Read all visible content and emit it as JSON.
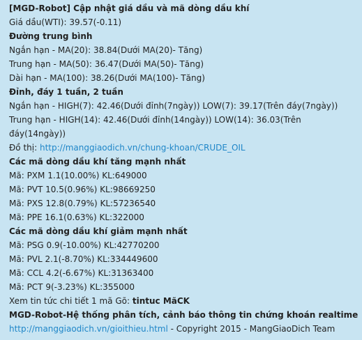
{
  "message": {
    "title": "[MGD-Robot] Cập nhật giá dầu và mã dòng dầu khí",
    "price": "Giá dầu(WTI): 39.57(-0.11)",
    "ma_heading": "Đường trung bình",
    "ma": [
      "Ngắn hạn - MA(20): 38.84(Dưới MA(20)- Tăng)",
      "Trung hạn - MA(50): 36.47(Dưới MA(50)- Tăng)",
      "Dài hạn - MA(100): 38.26(Dưới MA(100)- Tăng)"
    ],
    "peak_heading": "Đỉnh, đáy 1 tuần, 2 tuần",
    "peak": [
      "Ngắn hạn - HIGH(7): 42.46(Dưới đỉnh(7ngày)) LOW(7): 39.17(Trên đáy(7ngày))",
      "Trung hạn - HIGH(14): 42.46(Dưới đỉnh(14ngày)) LOW(14): 36.03(Trên đáy(14ngày))"
    ],
    "chart_label": "Đồ thị: ",
    "chart_link": "http://manggiaodich.vn/chung-khoan/CRUDE_OIL",
    "up_heading": "Các mã dòng dầu khí tăng mạnh nhất",
    "up": [
      "Mã: PXM 1.1(10.00%) KL:649000",
      "Mã: PVT 10.5(0.96%) KL:98669250",
      "Mã: PXS 12.8(0.79%) KL:57236540",
      "Mã: PPE 16.1(0.63%) KL:322000"
    ],
    "down_heading": "Các mã dòng dầu khí giảm mạnh nhất",
    "down": [
      "Mã: PSG 0.9(-10.00%) KL:42770200",
      "Mã: PVL 2.1(-8.70%) KL:334449600",
      "Mã: CCL 4.2(-6.67%) KL:31363400",
      "Mã: PCT 9(-3.23%) KL:355000"
    ],
    "detail_prefix": "Xem tin tức chi tiết 1 mã Gõ: ",
    "detail_command": "tintuc MãCK",
    "footer_title": "MGD-Robot-Hệ thống phân tích, cảnh báo thông tin chứng khoán realtime",
    "footer_link": "http://manggiaodich.vn/gioithieu.html",
    "footer_copyright": " - Copyright 2015 - MangGiaoDich Team"
  }
}
